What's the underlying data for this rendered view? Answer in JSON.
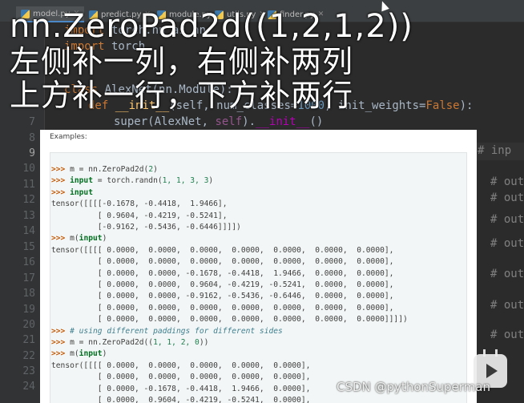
{
  "tabs": [
    {
      "label": "model.py",
      "active": true
    },
    {
      "label": "predict.py",
      "active": false
    },
    {
      "label": "module.py",
      "active": false
    },
    {
      "label": "utils.py",
      "active": false
    },
    {
      "label": "finder.py",
      "active": false
    }
  ],
  "overlay": {
    "line1": "nn.ZeroPad2d((1,2,1,2))",
    "line2": "左侧补一列，右侧补两列",
    "line3": "上方补一行，下方补两行"
  },
  "editor": {
    "line_numbers": [
      "7",
      "8",
      "9",
      "10",
      "11",
      "12",
      "13",
      "14",
      "15",
      "16",
      "17",
      "18",
      "19",
      "20",
      "21",
      "22",
      "23",
      "24"
    ],
    "current_line": "9",
    "code": {
      "l1_kw": "import",
      "l1_rest": " torch.nn as nn",
      "l2_kw": "import",
      "l2_rest": " torch",
      "l3_kw": "class",
      "l3_name": " AlexNet",
      "l3_rest": "(nn.Module):",
      "l4_kw": "def",
      "l4_fn": " __init__",
      "l4_a": "(self, num_classes=",
      "l4_num": "1000",
      "l4_b": ", init_weights=",
      "l4_kw2": "False",
      "l4_c": "):",
      "l5_a": "super",
      "l5_b": "(AlexNet, ",
      "l5_self": "self",
      "l5_c": ").",
      "l5_magic": "__init__",
      "l5_d": "()"
    },
    "right_comments": [
      "# inp",
      "# out",
      "# out",
      "# out",
      "# out",
      "# out",
      "# out",
      "# out"
    ]
  },
  "doc": {
    "title": "Examples:",
    "lines": [
      {
        "p": ">>> ",
        "a": "m = nn.ZeroPad2d(",
        "n": "2",
        "b": ")"
      },
      {
        "p": ">>> ",
        "kw": "input",
        "a": " = torch.randn(",
        "n": "1, 1, 3, 3",
        "b": ")"
      },
      {
        "p": ">>> ",
        "kw": "input"
      },
      {
        "t": "tensor([[[[-0.1678, -0.4418,  1.9466],"
      },
      {
        "t": "          [ 0.9604, -0.4219, -0.5241],"
      },
      {
        "t": "          [-0.9162, -0.5436, -0.6446]]]])"
      },
      {
        "p": ">>> ",
        "a": "m(",
        "kw": "input",
        "b": ")"
      },
      {
        "t": "tensor([[[[ 0.0000,  0.0000,  0.0000,  0.0000,  0.0000,  0.0000,  0.0000],"
      },
      {
        "t": "          [ 0.0000,  0.0000,  0.0000,  0.0000,  0.0000,  0.0000,  0.0000],"
      },
      {
        "t": "          [ 0.0000,  0.0000, -0.1678, -0.4418,  1.9466,  0.0000,  0.0000],"
      },
      {
        "t": "          [ 0.0000,  0.0000,  0.9604, -0.4219, -0.5241,  0.0000,  0.0000],"
      },
      {
        "t": "          [ 0.0000,  0.0000, -0.9162, -0.5436, -0.6446,  0.0000,  0.0000],"
      },
      {
        "t": "          [ 0.0000,  0.0000,  0.0000,  0.0000,  0.0000,  0.0000,  0.0000],"
      },
      {
        "t": "          [ 0.0000,  0.0000,  0.0000,  0.0000,  0.0000,  0.0000,  0.0000]]]])"
      },
      {
        "p": ">>> ",
        "c": "# using different paddings for different sides"
      },
      {
        "p": ">>> ",
        "a": "m = nn.ZeroPad2d((",
        "n": "1, 1, 2, 0",
        "b": "))"
      },
      {
        "p": ">>> ",
        "a": "m(",
        "kw": "input",
        "b": ")"
      },
      {
        "t": "tensor([[[[ 0.0000,  0.0000,  0.0000,  0.0000,  0.0000],"
      },
      {
        "t": "          [ 0.0000,  0.0000,  0.0000,  0.0000,  0.0000],"
      },
      {
        "t": "          [ 0.0000, -0.1678, -0.4418,  1.9466,  0.0000],"
      },
      {
        "t": "          [ 0.0000,  0.9604, -0.4219, -0.5241,  0.0000],"
      }
    ]
  },
  "watermark": "CSDN @pythonSuperman",
  "colors": {
    "editor_bg": "#2b2b2b",
    "keyword": "#cc7832",
    "doc_bg": "#ffffff"
  }
}
